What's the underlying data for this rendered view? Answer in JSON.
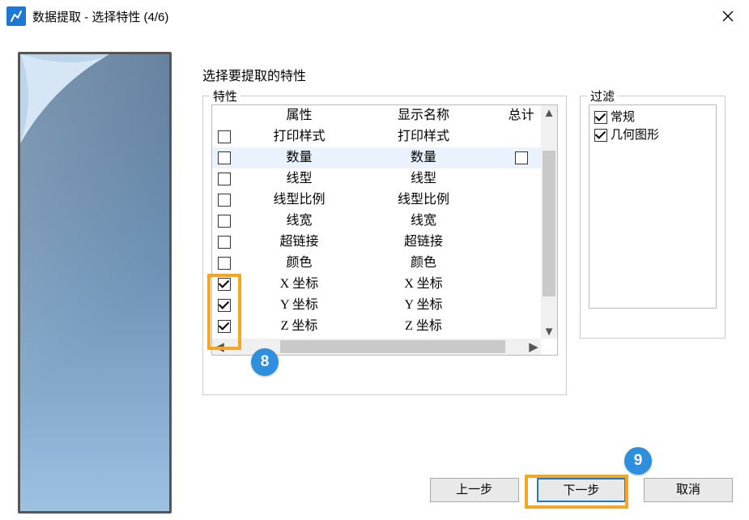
{
  "window": {
    "title": "数据提取  -  选择特性 (4/6)"
  },
  "caption": "选择要提取的特性",
  "properties_group": {
    "legend": "特性",
    "columns": {
      "attr": "属性",
      "display": "显示名称",
      "total": "总计"
    },
    "rows": [
      {
        "checked": false,
        "attr": "打印样式",
        "display": "打印样式",
        "highlight": false,
        "show_total_box": false
      },
      {
        "checked": false,
        "attr": "数量",
        "display": "数量",
        "highlight": true,
        "show_total_box": true
      },
      {
        "checked": false,
        "attr": "线型",
        "display": "线型",
        "highlight": false,
        "show_total_box": false
      },
      {
        "checked": false,
        "attr": "线型比例",
        "display": "线型比例",
        "highlight": false,
        "show_total_box": false
      },
      {
        "checked": false,
        "attr": "线宽",
        "display": "线宽",
        "highlight": false,
        "show_total_box": false
      },
      {
        "checked": false,
        "attr": "超链接",
        "display": "超链接",
        "highlight": false,
        "show_total_box": false
      },
      {
        "checked": false,
        "attr": "颜色",
        "display": "颜色",
        "highlight": false,
        "show_total_box": false
      },
      {
        "checked": true,
        "attr": "X 坐标",
        "display": "X 坐标",
        "highlight": false,
        "show_total_box": false
      },
      {
        "checked": true,
        "attr": "Y 坐标",
        "display": "Y 坐标",
        "highlight": false,
        "show_total_box": false
      },
      {
        "checked": true,
        "attr": "Z 坐标",
        "display": "Z 坐标",
        "highlight": false,
        "show_total_box": false
      }
    ]
  },
  "filter_group": {
    "legend": "过滤",
    "items": [
      {
        "checked": true,
        "label": "常规"
      },
      {
        "checked": true,
        "label": "几何图形"
      }
    ]
  },
  "buttons": {
    "prev": "上一步",
    "next": "下一步",
    "cancel": "取消"
  },
  "annotations": {
    "step_a": "8",
    "step_b": "9"
  }
}
